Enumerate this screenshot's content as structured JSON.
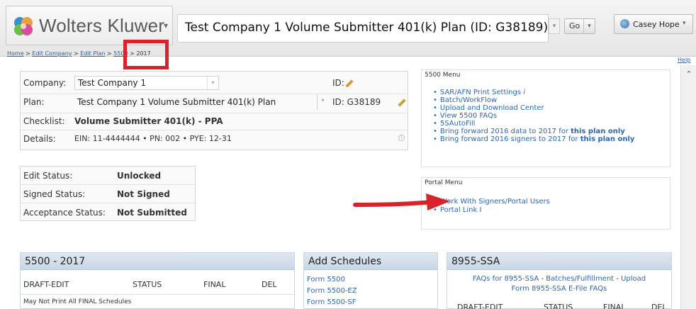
{
  "header": {
    "logo_text": "Wolters Kluwer",
    "logo_caret": "▾",
    "plan_title": "Test Company 1 Volume Submitter 401(k) Plan (ID: G38189)",
    "go_label": "Go",
    "user_name": "Casey Hope"
  },
  "breadcrumb": {
    "home": "Home",
    "edit_company": "Edit Company",
    "edit_plan": "Edit Plan",
    "form_5500": "5500",
    "year": "2017",
    "sep": " > "
  },
  "help": "Help",
  "plan_info": {
    "company_label": "Company:",
    "company_value": "Test Company 1",
    "id_label": "ID:",
    "plan_label": "Plan:",
    "plan_value": "Test Company 1 Volume Submitter 401(k) Plan",
    "plan_id": "ID: G38189",
    "checklist_label": "Checklist:",
    "checklist_value": "Volume Submitter 401(k) - PPA",
    "details_label": "Details:",
    "details_value": "EIN: 11-4444444 • PN: 002 • PYE: 12-31"
  },
  "status": {
    "edit_label": "Edit Status:",
    "edit_value": "Unlocked",
    "signed_label": "Signed Status:",
    "signed_value": "Not Signed",
    "accept_label": "Acceptance Status:",
    "accept_value": "Not Submitted"
  },
  "menu_5500": {
    "title": "5500 Menu",
    "items": {
      "sar": "SAR/AFN Print Settings",
      "sar_info": "i",
      "batch": "Batch/WorkFlow",
      "upload": "Upload and Download Center",
      "faqs": "View 5500 FAQs",
      "autofill": "5SAutoFill",
      "bring_data": "Bring forward 2016 data to 2017 for ",
      "bring_signers": "Bring forward 2016 signers to 2017 for ",
      "this_plan_only": "this plan only"
    }
  },
  "portal_menu": {
    "title": "Portal Menu",
    "items": [
      "Work With Signers/Portal Users",
      "Portal Link I"
    ]
  },
  "panel_5500": {
    "title": "5500 - 2017",
    "cols": [
      "DRAFT-EDIT",
      "STATUS",
      "FINAL",
      "DEL"
    ],
    "note": "May Not Print All FINAL Schedules"
  },
  "panel_schedules": {
    "title": "Add Schedules",
    "links": [
      "Form 5500",
      "Form 5500-EZ",
      "Form 5500-SF"
    ]
  },
  "panel_ssa": {
    "title": "8955-SSA",
    "link_faqs": "FAQs for 8955-SSA",
    "link_batches": "Batches/Fulfillment",
    "link_upload": "Upload",
    "link_efile": "Form 8955-SSA E-File FAQs",
    "sep": " - ",
    "cols": [
      "DRAFT-EDIT",
      "STATUS",
      "FINAL",
      "DEL"
    ]
  },
  "colors": {
    "accent_red": "#d9232a",
    "link_blue": "#2a66b5",
    "panel_header": "#c9d7e5"
  }
}
